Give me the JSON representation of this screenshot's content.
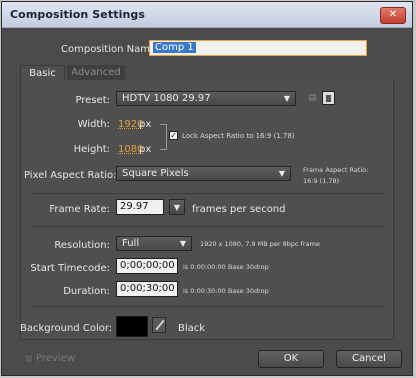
{
  "window": {
    "title": "Composition Settings",
    "close_label": "✕"
  },
  "comp_name": {
    "label": "Composition Name:",
    "value": "Comp 1"
  },
  "tabs": [
    {
      "label": "Basic"
    },
    {
      "label": "Advanced"
    }
  ],
  "preset": {
    "label": "Preset:",
    "value": "HDTV 1080 29.97"
  },
  "width": {
    "label": "Width:",
    "value": "1920",
    "unit": "px"
  },
  "height": {
    "label": "Height:",
    "value": "1080",
    "unit": "px"
  },
  "lock_aspect": {
    "label": "Lock Aspect Ratio to 16:9 (1.78)",
    "checked": true
  },
  "pixel_aspect": {
    "label": "Pixel Aspect Ratio:",
    "value": "Square Pixels"
  },
  "frame_aspect": {
    "line1": "Frame Aspect Ratio:",
    "line2": "16:9 (1.78)"
  },
  "frame_rate": {
    "label": "Frame Rate:",
    "value": "29.97",
    "unit": "frames per second"
  },
  "resolution": {
    "label": "Resolution:",
    "value": "Full",
    "info": "1920 x 1080, 7.9 MB per 8bpc frame"
  },
  "start_timecode": {
    "label": "Start Timecode:",
    "value": "0;00;00;00",
    "info": "is 0:00:00:00  Base 30drop"
  },
  "duration": {
    "label": "Duration:",
    "value": "0;00;30;00",
    "info": "is 0:00:30:00  Base 30drop"
  },
  "background": {
    "label": "Background Color:",
    "color": "#000000",
    "name": "Black"
  },
  "preview": {
    "label": "Preview"
  },
  "buttons": {
    "ok": "OK",
    "cancel": "Cancel"
  },
  "icons": {
    "save": "save-preset-icon",
    "delete": "trash-icon",
    "eyedropper": "eyedropper-icon"
  }
}
